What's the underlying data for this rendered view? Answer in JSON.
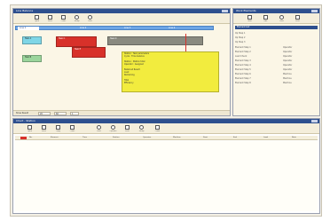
{
  "colors": {
    "title_bar": "#2d4f8e",
    "tab_strip": "#6ea6e6",
    "task_red": "#d8312a",
    "task_gray": "#8a8a80",
    "task_cyan": "#7fd6e6",
    "task_green": "#9bd59c",
    "task_yellow": "#f2ec3e",
    "window_bg": "#fbf6e6"
  },
  "top_left_window": {
    "title": "Line Balance",
    "toolbar": [
      {
        "icon": "document-icon",
        "label": "Open"
      },
      {
        "icon": "document-icon",
        "label": "Save"
      },
      {
        "icon": "chart-icon",
        "label": "Chart"
      },
      {
        "icon": "gear-icon",
        "label": "Setup"
      },
      {
        "icon": "search-icon",
        "label": "Find"
      }
    ],
    "tabs": [
      {
        "label": "Line 1",
        "active": true
      },
      {
        "label": "Line 2",
        "active": false
      },
      {
        "label": "Line 3",
        "active": false
      },
      {
        "label": "Line 4",
        "active": false
      }
    ],
    "tasks": [
      {
        "label": "Task A",
        "color": "task_cyan"
      },
      {
        "label": "Task B",
        "color": "task_green"
      },
      {
        "label": "Task C",
        "color": "task_red"
      },
      {
        "label": "Task D",
        "color": "task_gray"
      },
      {
        "label": "Task E",
        "color": "task_red"
      }
    ],
    "detail_lines": [
      "Station : Task parameters",
      "Cycle : Time balance",
      "",
      "Station : Station total",
      "Operator : Assigned",
      "",
      "Balanced Result",
      "Load",
      "Remaining",
      "",
      "Total",
      "Efficiency"
    ],
    "status": {
      "label": "Show Result",
      "field1": "20",
      "field2": "60",
      "field3": "1"
    }
  },
  "top_right_window": {
    "title": "Work Elements",
    "toolbar": [
      {
        "icon": "document-icon",
        "label": "New"
      },
      {
        "icon": "document-icon",
        "label": "Edit"
      },
      {
        "icon": "search-icon",
        "label": "Find"
      },
      {
        "icon": "document-icon",
        "label": "Print"
      }
    ],
    "list_header": "Element List",
    "rows": [
      {
        "name": "Op Step 1",
        "value": ""
      },
      {
        "name": "Op Step 2",
        "value": ""
      },
      {
        "name": "Op Step 3",
        "value": ""
      },
      {
        "name": "Element Step 1",
        "value": "Operator"
      },
      {
        "name": "Element Step 2",
        "value": "Operator"
      },
      {
        "name": "Load Check",
        "value": "Operator"
      },
      {
        "name": "Element Step 3",
        "value": "Operator"
      },
      {
        "name": "Element Step 4",
        "value": "Operator"
      },
      {
        "name": "Element Step 5",
        "value": "Operator"
      },
      {
        "name": "Element Step 6",
        "value": "Machine"
      },
      {
        "name": "Element Step 7",
        "value": "Machine"
      },
      {
        "name": "Element Step 8",
        "value": "Machine"
      }
    ]
  },
  "bottom_window": {
    "title": "Chart - Station",
    "toolbar": [
      {
        "icon": "document-icon",
        "label": "Open"
      },
      {
        "icon": "document-icon",
        "label": "Save"
      },
      {
        "icon": "document-icon",
        "label": "Copy"
      },
      {
        "icon": "chart-icon",
        "label": "Chart"
      },
      {
        "icon": "search-icon",
        "label": "Find"
      },
      {
        "icon": "gear-icon",
        "label": "Options"
      },
      {
        "icon": "document-icon",
        "label": "Print"
      },
      {
        "icon": "gear-icon",
        "label": "Setup"
      },
      {
        "icon": "close-icon",
        "label": "Close"
      }
    ],
    "columns": [
      "No.",
      "Element",
      "Time",
      "Station",
      "Operator",
      "Machine",
      "Start",
      "End",
      "Load",
      "Note"
    ]
  }
}
